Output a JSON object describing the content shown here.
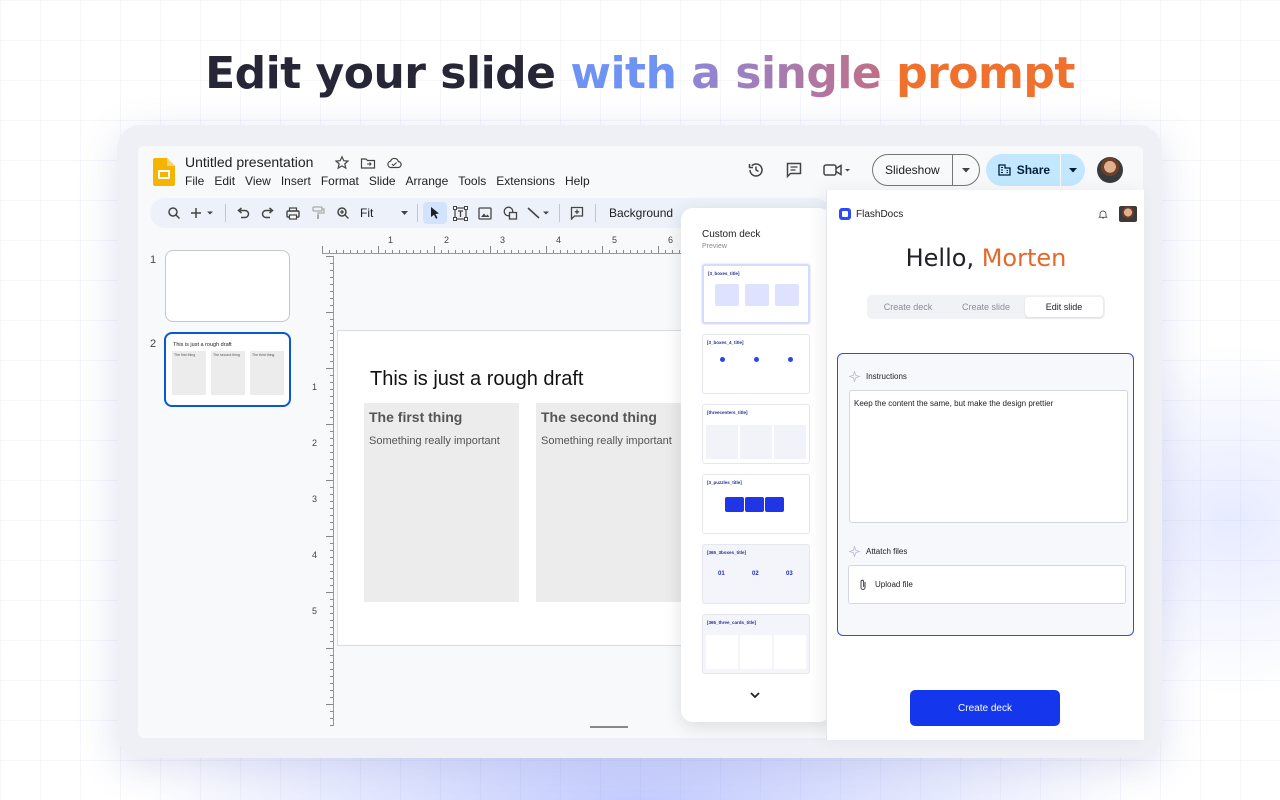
{
  "headline": {
    "part1": "Edit your slide",
    "part2": "with",
    "part3": "a single",
    "part4": "prompt"
  },
  "slides": {
    "doc_title": "Untitled presentation",
    "menu": [
      "File",
      "Edit",
      "View",
      "Insert",
      "Format",
      "Slide",
      "Arrange",
      "Tools",
      "Extensions",
      "Help"
    ],
    "slideshow_label": "Slideshow",
    "share_label": "Share",
    "zoom": "Fit",
    "background_label": "Background",
    "thumbnails": [
      {
        "number": "1"
      },
      {
        "number": "2",
        "title": "This is just a rough draft",
        "cols": [
          "The first thing",
          "The second thing",
          "The third thing"
        ]
      }
    ],
    "ruler_top": [
      "1",
      "2",
      "3",
      "4",
      "5",
      "6"
    ],
    "ruler_left": [
      "1",
      "2",
      "3",
      "4",
      "5"
    ],
    "slide": {
      "title": "This is just a rough draft",
      "columns": [
        {
          "heading": "The first thing",
          "body": "Something really important"
        },
        {
          "heading": "The second thing",
          "body": "Something really important"
        }
      ]
    }
  },
  "deck": {
    "title": "Custom deck",
    "subtitle": "Preview",
    "layouts": [
      {
        "label": "[3_boxes_title]"
      },
      {
        "label": "[3_boxes_4_title]"
      },
      {
        "label": "[threecenters_title]"
      },
      {
        "label": "[3_puzzles_title]"
      },
      {
        "label": "[365_3boxes_title]",
        "numbers": [
          "01",
          "02",
          "03"
        ]
      },
      {
        "label": "[365_three_cards_title]"
      }
    ]
  },
  "flashdocs": {
    "brand": "FlashDocs",
    "greeting": "Hello,",
    "user": "Morten",
    "tabs": [
      "Create deck",
      "Create slide",
      "Edit slide"
    ],
    "active_tab": "Edit slide",
    "instructions_label": "Instructions",
    "instructions_value": "Keep the content the same, but make the design prettier",
    "attach_label": "Attatch files",
    "upload_label": "Upload file",
    "create_button": "Create deck"
  },
  "colors": {
    "accent": "#1437ee",
    "brand_orange": "#e2692c",
    "selection": "#0b57d0",
    "share_bg": "#c2e7ff"
  }
}
